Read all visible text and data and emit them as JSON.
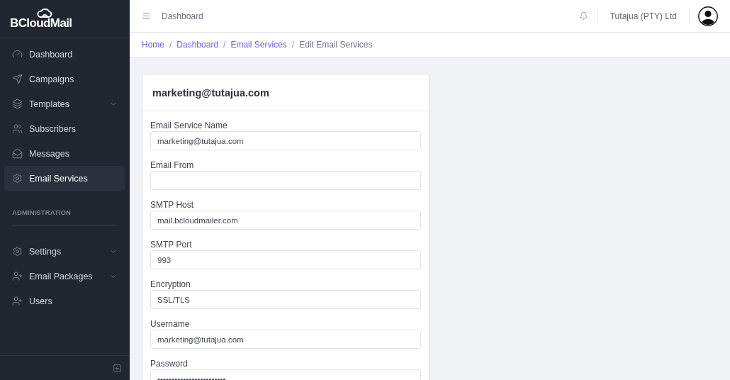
{
  "sidebar": {
    "logo": "BCloudMail",
    "sections": [
      {
        "items": [
          {
            "label": "Dashboard",
            "kind": "link",
            "selected": false
          },
          {
            "label": "Campaigns",
            "kind": "link",
            "selected": false
          },
          {
            "label": "Templates",
            "kind": "group",
            "selected": false
          },
          {
            "label": "Subscribers",
            "kind": "link",
            "selected": false
          },
          {
            "label": "Messages",
            "kind": "link",
            "selected": false
          },
          {
            "label": "Email Services",
            "kind": "link",
            "selected": true
          }
        ]
      },
      {
        "heading": "ADMINISTRATION",
        "items": [
          {
            "label": "Settings",
            "kind": "group",
            "selected": false
          },
          {
            "label": "Email Packages",
            "kind": "group",
            "selected": false
          },
          {
            "label": "Users",
            "kind": "link",
            "selected": false
          }
        ]
      }
    ]
  },
  "header": {
    "title": "Dashboard",
    "account": "Tutajua (PTY) Ltd"
  },
  "breadcrumb": [
    {
      "kind": "link",
      "text": "Home"
    },
    {
      "kind": "separator",
      "text": "/"
    },
    {
      "kind": "link",
      "text": "Dashboard"
    },
    {
      "kind": "separator",
      "text": "/"
    },
    {
      "kind": "link",
      "text": "Email Services"
    },
    {
      "kind": "separator",
      "text": "/"
    },
    {
      "kind": "current",
      "text": "Edit Email Services"
    }
  ],
  "form": {
    "title": "marketing@tutajua.com",
    "fields": [
      {
        "label": "Email Service Name",
        "value": "marketing@tutajua.com"
      },
      {
        "label": "Email From"
      },
      {
        "label": "SMTP Host",
        "value": "mail.bcloudmailer.com"
      },
      {
        "label": "SMTP Port",
        "value": "993"
      },
      {
        "label": "Encryption",
        "value": "SSL/TLS"
      },
      {
        "label": "Username",
        "value": "marketing@tutajua.com"
      },
      {
        "label": "Password",
        "value": "••••••••••••••••••••••••"
      }
    ]
  }
}
